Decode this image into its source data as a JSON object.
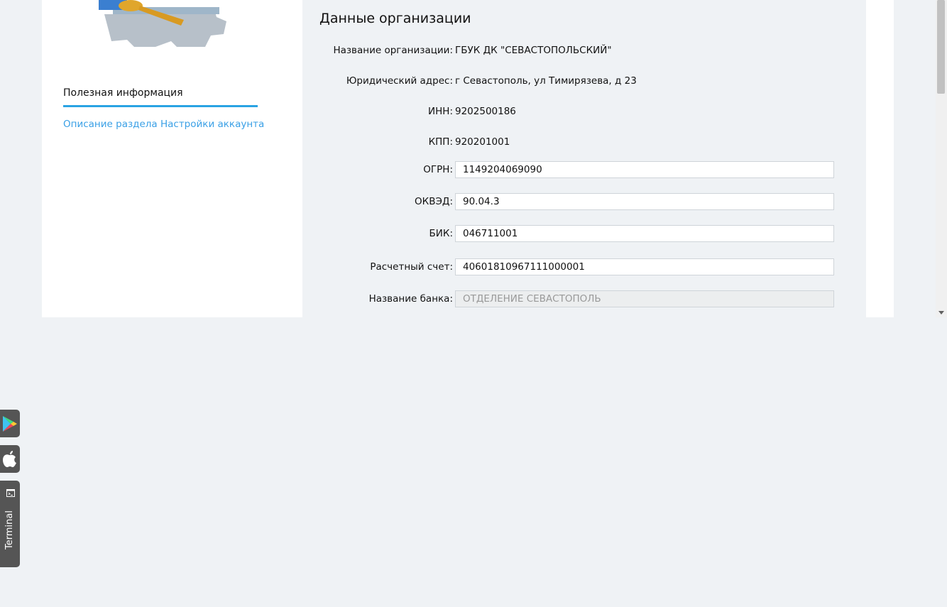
{
  "sidebar": {
    "info_title": "Полезная информация",
    "info_link": "Описание раздела Настройки аккаунта"
  },
  "panel": {
    "title": "Данные организации",
    "static_fields": [
      {
        "label": "Название организации:",
        "value": "ГБУК ДК \"СЕВАСТОПОЛЬСКИЙ\""
      },
      {
        "label": "Юридический адрес:",
        "value": "г Севастополь, ул Тимирязева, д 23"
      },
      {
        "label": "ИНН:",
        "value": "9202500186"
      },
      {
        "label": "КПП:",
        "value": "920201001"
      }
    ],
    "input_fields": [
      {
        "label": "ОГРН:",
        "value": "1149204069090"
      },
      {
        "label": "ОКВЭД:",
        "value": "90.04.3"
      },
      {
        "label": "БИК:",
        "value": "046711001"
      },
      {
        "label": "Расчетный счет:",
        "value": "40601810967111000001"
      },
      {
        "label": "Название банка:",
        "value": "ОТДЕЛЕНИЕ СЕВАСТОПОЛЬ"
      }
    ]
  },
  "side_tabs": {
    "terminal": "Terminal"
  }
}
